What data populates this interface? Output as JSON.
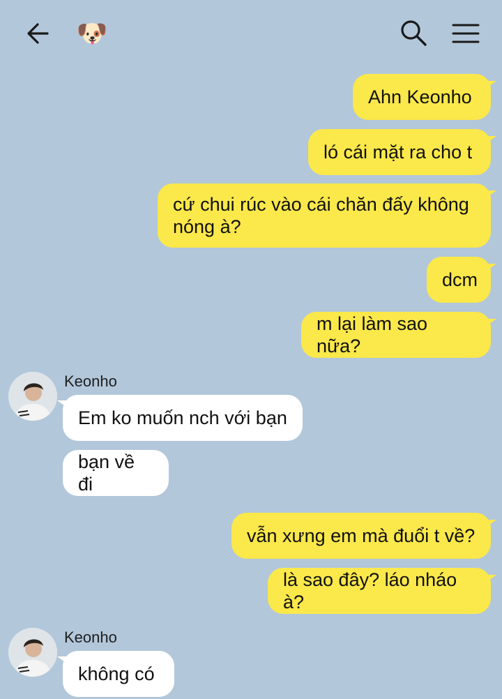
{
  "header": {
    "chat_avatar_emoji": "🐶",
    "icons": [
      "back-arrow-icon",
      "search-icon",
      "menu-icon"
    ]
  },
  "messages": [
    {
      "from": "me",
      "text": "Ahn Keonho"
    },
    {
      "from": "me",
      "text": "ló cái mặt ra cho t"
    },
    {
      "from": "me",
      "text": "cứ chui rúc vào cái chăn đấy không nóng à?"
    },
    {
      "from": "me",
      "text": "dcm"
    },
    {
      "from": "me",
      "text": "m lại làm sao nữa?"
    },
    {
      "from": "Keonho",
      "text": "Em ko muốn nch với bạn"
    },
    {
      "from": "Keonho",
      "text": "bạn về đi"
    },
    {
      "from": "me",
      "text": "vẫn xưng em mà đuổi t về?"
    },
    {
      "from": "me",
      "text": "là sao đây? láo nháo à?"
    },
    {
      "from": "Keonho",
      "text": "không có"
    }
  ],
  "sender_name": "Keonho",
  "colors": {
    "background": "#b2c7da",
    "outgoing_bubble": "#fbe84a",
    "incoming_bubble": "#ffffff"
  }
}
